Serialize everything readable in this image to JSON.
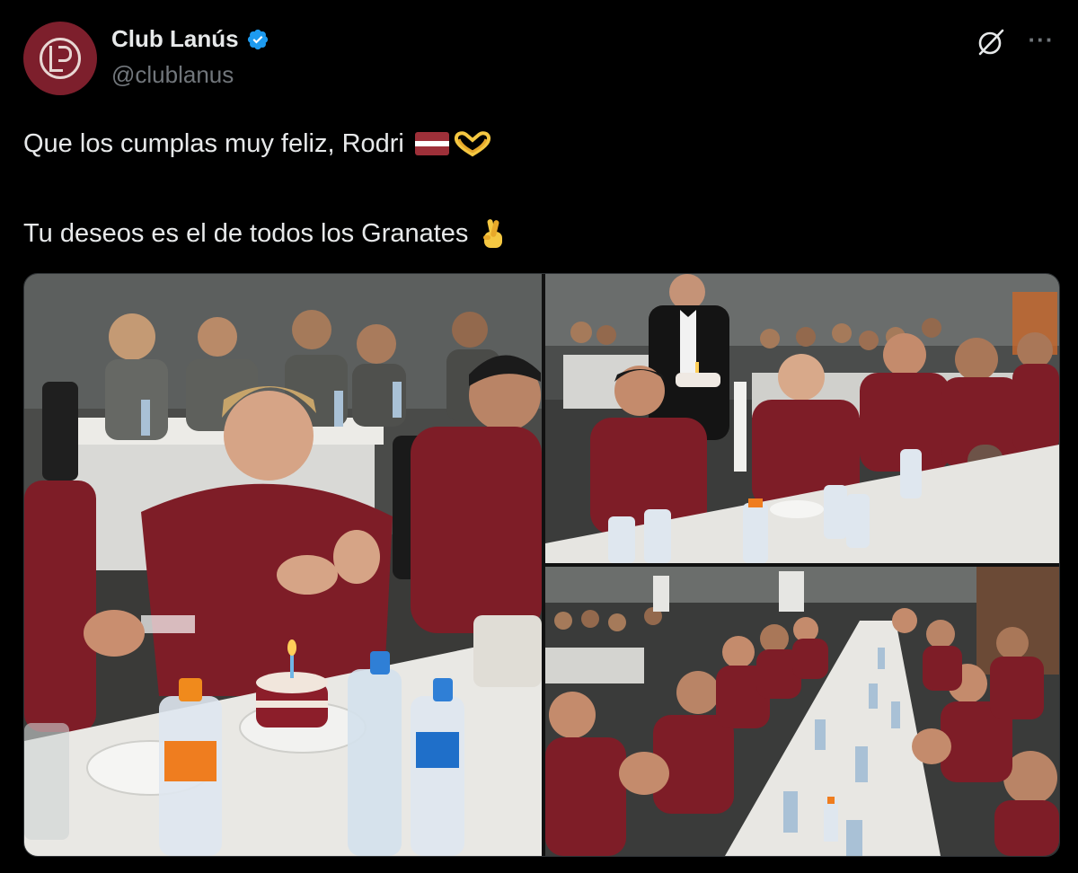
{
  "tweet": {
    "display_name": "Club Lanús",
    "handle": "@clublanus",
    "line1": "Que los cumplas muy feliz, Rodri",
    "line2": "Tu deseos es el de todos los Granates",
    "emojis": [
      "flag-icon",
      "heart-hands-icon",
      "crossed-fingers-icon"
    ]
  },
  "icons": {
    "verified": "verified-badge-icon",
    "grok": "grok-icon",
    "more": "more-icon"
  },
  "media": {
    "photo_count": 3
  },
  "colors": {
    "background": "#000000",
    "text": "#e7e9ea",
    "muted": "#71767b",
    "verified": "#1d9bf0",
    "brand": "#7d1f2c"
  }
}
